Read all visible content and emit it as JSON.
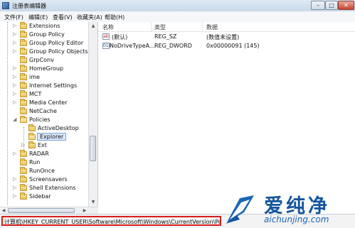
{
  "window": {
    "title": "注册表编辑器",
    "controls": {
      "minimize": "–",
      "maximize": "□",
      "close": "✕"
    }
  },
  "menu": [
    {
      "label": "文件(F)"
    },
    {
      "label": "编辑(E)"
    },
    {
      "label": "查看(V)"
    },
    {
      "label": "收藏夹(A)"
    },
    {
      "label": "帮助(H)"
    }
  ],
  "tree": {
    "items": [
      {
        "label": "Extensions",
        "expander": "▷"
      },
      {
        "label": "Group Policy",
        "expander": "▷"
      },
      {
        "label": "Group Policy Editor",
        "expander": "▷"
      },
      {
        "label": "Group Policy Objects",
        "expander": "▷"
      },
      {
        "label": "GrpConv",
        "expander": ""
      },
      {
        "label": "HomeGroup",
        "expander": "▷"
      },
      {
        "label": "ime",
        "expander": "▷"
      },
      {
        "label": "Internet Settings",
        "expander": "▷"
      },
      {
        "label": "MCT",
        "expander": "▷"
      },
      {
        "label": "Media Center",
        "expander": "▷"
      },
      {
        "label": "NetCache",
        "expander": ""
      },
      {
        "label": "Policies",
        "expander": "◢"
      },
      {
        "label": "ActiveDesktop",
        "expander": ""
      },
      {
        "label": "Explorer",
        "expander": "",
        "selected": true
      },
      {
        "label": "Ext",
        "expander": "▷"
      },
      {
        "label": "RADAR",
        "expander": "▷"
      },
      {
        "label": "Run",
        "expander": ""
      },
      {
        "label": "RunOnce",
        "expander": ""
      },
      {
        "label": "Screensavers",
        "expander": "▷"
      },
      {
        "label": "Shell Extensions",
        "expander": "▷"
      },
      {
        "label": "Sidebar",
        "expander": "▷"
      }
    ],
    "scroll_up": "▲",
    "scroll_down": "▼",
    "scroll_left": "◀",
    "scroll_right": "▶"
  },
  "values": {
    "columns": {
      "name": "名称",
      "type": "类型",
      "data": "数据"
    },
    "rows": [
      {
        "icon": "ab",
        "icon_name": "string-value-icon",
        "name": "(默认)",
        "type": "REG_SZ",
        "data": "(数值未设置)"
      },
      {
        "icon": "011",
        "icon_name": "binary-value-icon",
        "name": "NoDriveTypeA...",
        "type": "REG_DWORD",
        "data": "0x00000091 (145)"
      }
    ]
  },
  "status": {
    "path": "计算机\\HKEY_CURRENT_USER\\Software\\Microsoft\\Windows\\CurrentVersion\\Policies\\E"
  },
  "watermark": {
    "brand": "爱纯净",
    "url": "aichunjing.com"
  },
  "colors": {
    "status_highlight": "#d81e1e",
    "selection_bg": "#d9e8fb",
    "watermark_blue": "#15569c"
  }
}
